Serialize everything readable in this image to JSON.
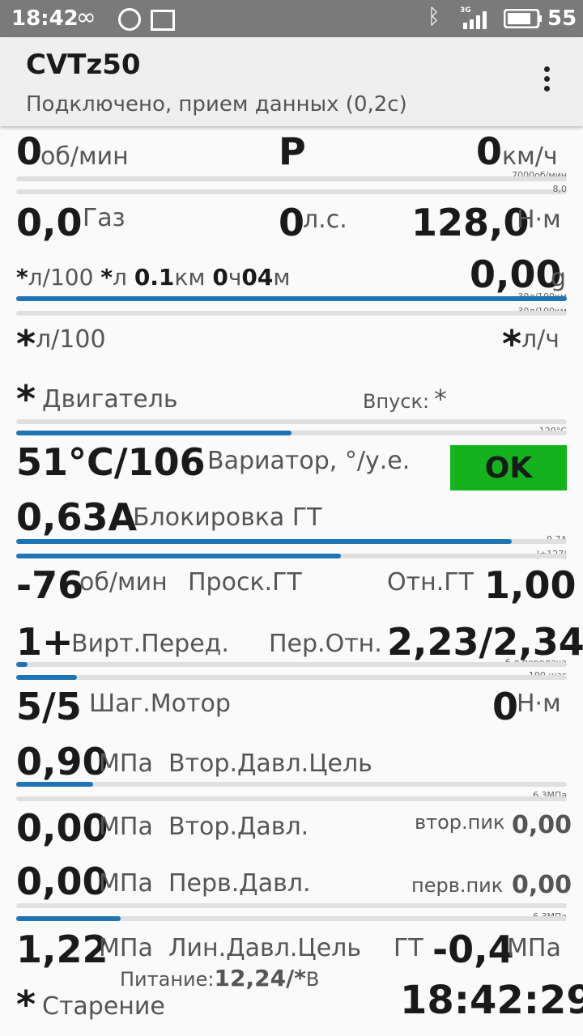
{
  "status_bar": {
    "time": "18:42",
    "network": "3G",
    "battery": "55"
  },
  "app": {
    "title": "CVTz50",
    "subtitle": "Подключено, прием данных (0,2с)"
  },
  "row1": {
    "rpm": "0",
    "rpm_unit": "об/мин",
    "gear": "P",
    "speed": "0",
    "speed_unit": "км/ч"
  },
  "scale1": {
    "rpm_max": "7000об/мин",
    "second": "8,0"
  },
  "row2": {
    "throttle": "0,0",
    "throttle_label": "Газ",
    "power": "0",
    "power_unit": "л.с.",
    "torque": "128,0",
    "torque_unit": "Н·м"
  },
  "row3": {
    "star1": "*",
    "unit1": "л/100",
    "star2": "*",
    "unit2": "л",
    "dist": "0.1",
    "dist_unit": "км",
    "h": "0",
    "h_unit": "ч",
    "m": "04",
    "m_unit": "м",
    "g": "0,00",
    "g_unit": "g"
  },
  "scale3": {
    "a": "30л/100км",
    "b": "30л/100км",
    "bar_fill": 1.0
  },
  "row4": {
    "star1": "*",
    "unit1": "л/100",
    "star2": "*",
    "unit2": "л/ч"
  },
  "row5": {
    "star": "*",
    "label": "Двигатель",
    "intake_label": "Впуск:",
    "intake_value": "*",
    "bar_fill": 0.5,
    "max": "120°С"
  },
  "row6": {
    "value": "51°C/106",
    "label": "Вариатор, °/у.е.",
    "status": "OK"
  },
  "row7": {
    "value": "0,63A",
    "label": "Блокировка ГТ",
    "bar1_fill": 0.9,
    "bar2_fill": 0.59,
    "max1": "0,7A",
    "max2": "|±127|"
  },
  "row8": {
    "slip": "-76",
    "slip_unit": "об/мин",
    "slip_label": "Проск.ГТ",
    "ratio_label": "Отн.ГТ",
    "ratio": "1,00"
  },
  "row9": {
    "gear": "1+",
    "gear_label": "Вирт.Перед.",
    "ratio_label": "Пер.Отн.",
    "ratio": "2,23/2,34",
    "bar1_fill": 0.02,
    "bar2_fill": 0.11,
    "max1": "6-я передача",
    "max2": "190 шаг"
  },
  "row10": {
    "step": "5/5",
    "label": "Шаг.Мотор",
    "torque": "0",
    "torque_unit": "Н·м"
  },
  "row11": {
    "value": "0,90",
    "unit": "МПа",
    "label": "Втор.Давл.Цель",
    "bar_fill": 0.14,
    "max": "6,3МПа"
  },
  "row12": {
    "value": "0,00",
    "unit": "МПа",
    "label": "Втор.Давл.",
    "peak_label": "втор.пик",
    "peak": "0,00"
  },
  "row13": {
    "value": "0,00",
    "unit": "МПа",
    "label": "Перв.Давл.",
    "peak_label": "перв.пик",
    "peak": "0,00",
    "bar_fill": 0.19,
    "max": "6,3МПа"
  },
  "row14": {
    "value": "1,22",
    "unit": "МПа",
    "label": "Лин.Давл.Цель",
    "gt_label": "ГТ",
    "gt": "-0,4",
    "gt_unit": "МПа"
  },
  "row15": {
    "power_label": "Питание:",
    "power_value": "12,24/*",
    "power_unit": "В",
    "star": "*",
    "aging": "Старение",
    "clock": "18:42:29"
  }
}
